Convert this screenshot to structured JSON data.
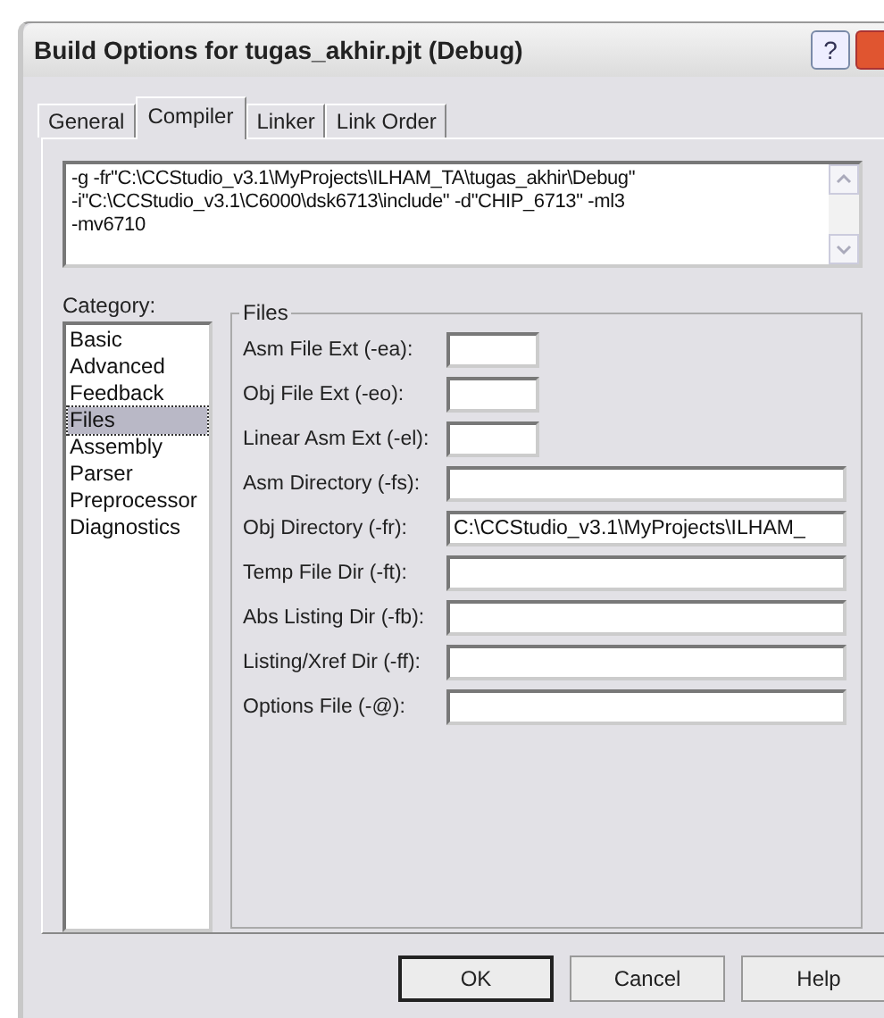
{
  "window": {
    "title": "Build Options for tugas_akhir.pjt (Debug)",
    "help_button": "?"
  },
  "tabs": [
    {
      "label": "General",
      "selected": false
    },
    {
      "label": "Compiler",
      "selected": true
    },
    {
      "label": "Linker",
      "selected": false
    },
    {
      "label": "Link Order",
      "selected": false
    }
  ],
  "command_line": [
    "-g -fr\"C:\\CCStudio_v3.1\\MyProjects\\ILHAM_TA\\tugas_akhir\\Debug\"",
    "-i\"C:\\CCStudio_v3.1\\C6000\\dsk6713\\include\" -d\"CHIP_6713\" -ml3",
    "-mv6710"
  ],
  "category": {
    "label": "Category:",
    "items": [
      {
        "label": "Basic",
        "selected": false
      },
      {
        "label": "Advanced",
        "selected": false
      },
      {
        "label": "Feedback",
        "selected": false
      },
      {
        "label": "Files",
        "selected": true
      },
      {
        "label": "Assembly",
        "selected": false
      },
      {
        "label": "Parser",
        "selected": false
      },
      {
        "label": "Preprocessor",
        "selected": false
      },
      {
        "label": "Diagnostics",
        "selected": false
      }
    ]
  },
  "files_group": {
    "title": "Files",
    "fields": [
      {
        "label": "Asm File Ext (-ea):",
        "kind": "short"
      },
      {
        "label": "Obj File Ext (-eo):",
        "kind": "short"
      },
      {
        "label": "Linear Asm Ext (-el):",
        "kind": "short"
      },
      {
        "label": "Asm Directory (-fs):",
        "kind": "wide"
      },
      {
        "label": "Obj Directory (-fr):",
        "kind": "wide",
        "value": "C:\\CCStudio_v3.1\\MyProjects\\ILHAM_"
      },
      {
        "label": "Temp File Dir (-ft):",
        "kind": "wide"
      },
      {
        "label": "Abs Listing Dir (-fb):",
        "kind": "wide"
      },
      {
        "label": "Listing/Xref Dir (-ff):",
        "kind": "wide"
      },
      {
        "label": "Options File (-@):",
        "kind": "wide"
      }
    ]
  },
  "buttons": [
    {
      "label": "OK",
      "default": true
    },
    {
      "label": "Cancel",
      "default": false
    },
    {
      "label": "Help",
      "default": false
    }
  ]
}
